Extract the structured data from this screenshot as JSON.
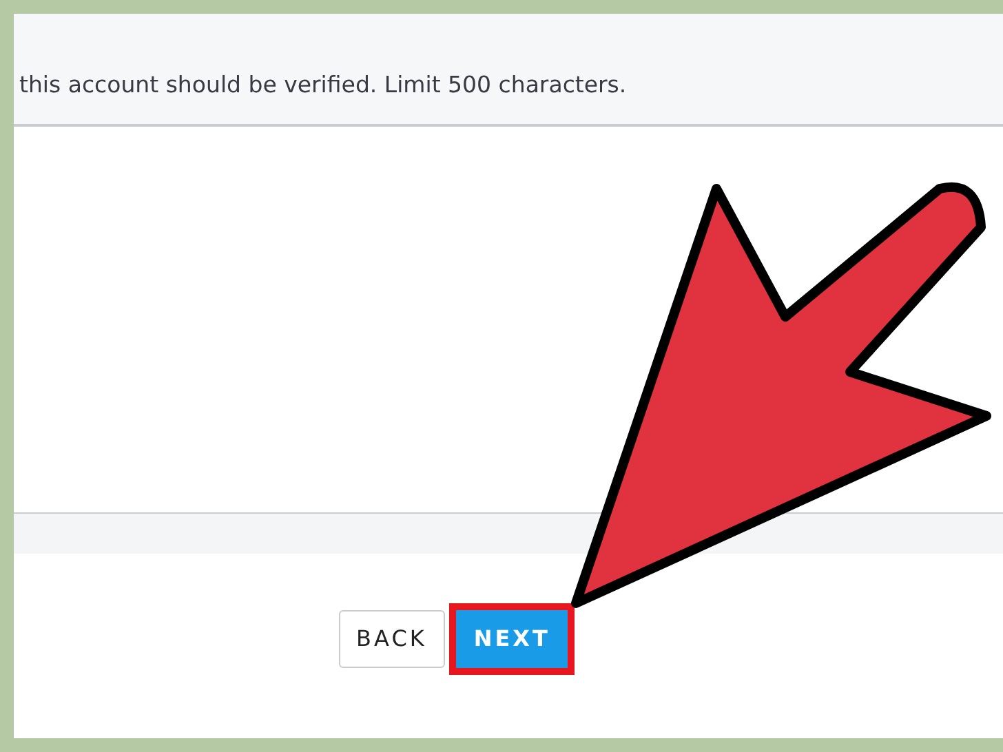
{
  "hint": "this account should be verified. Limit 500 characters.",
  "buttons": [
    {
      "label": "BACK",
      "kind": "secondary",
      "highlighted": false
    },
    {
      "label": "NEXT",
      "kind": "primary",
      "highlighted": true
    }
  ]
}
